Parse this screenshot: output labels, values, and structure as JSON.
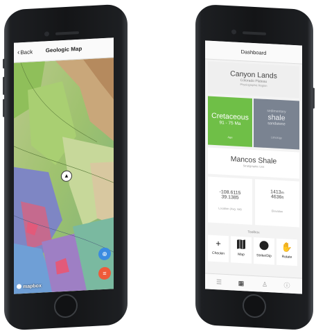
{
  "map_screen": {
    "back_label": "Back",
    "title": "Geologic Map",
    "attribution": "mapbox"
  },
  "dashboard": {
    "title": "Dashboard",
    "region": {
      "name": "Canyon Lands",
      "subname": "Colorado Plateau",
      "caption": "Physiographic Region"
    },
    "age": {
      "period": "Cretaceous",
      "range": "91 - 75",
      "unit": "Ma",
      "caption": "Age"
    },
    "rock": {
      "label_top": "sedimentary",
      "name": "shale",
      "sub": "sandstone",
      "caption": "Lithology"
    },
    "unit": {
      "name": "Mancos Shale",
      "caption": "Stratigraphic Unit"
    },
    "coords": {
      "lon": "-108.6115",
      "lat": "39.1385",
      "caption": "Location (Avg. Val)"
    },
    "elevation": {
      "meters": "1413",
      "m_unit": "m",
      "feet": "4636",
      "ft_unit": "ft",
      "caption": "Elevation"
    },
    "toolbox_label": "Toolbox",
    "tools": [
      {
        "label": "Checkin",
        "icon": "plus-icon"
      },
      {
        "label": "Map",
        "icon": "map-icon"
      },
      {
        "label": "Strike/Dip",
        "icon": "compass-icon"
      },
      {
        "label": "Rotate",
        "icon": "rotate-hand-icon"
      }
    ],
    "tabs": [
      "list-icon",
      "grid-icon",
      "person-icon",
      "help-icon"
    ]
  },
  "colors": {
    "age_green": "#6fbf47",
    "rock_gray": "#7a8391",
    "locate_blue": "#3b8be0",
    "layers_orange": "#ee5a3a"
  }
}
